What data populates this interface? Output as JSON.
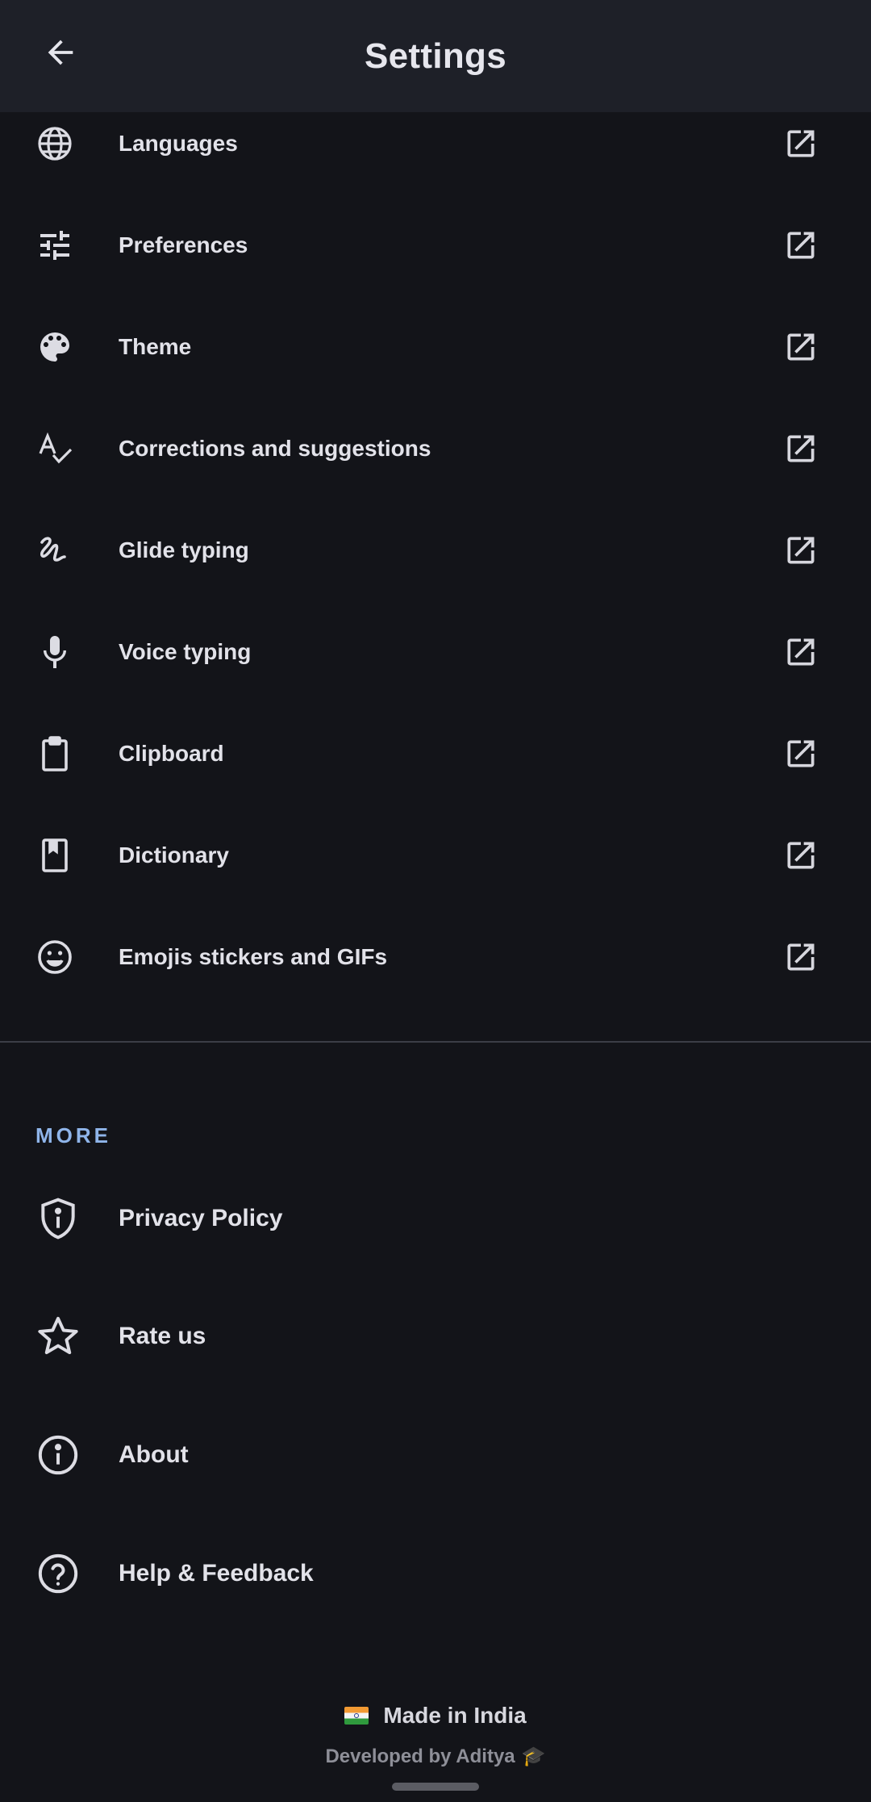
{
  "header": {
    "title": "Settings",
    "back_icon": "arrow-back-icon"
  },
  "settings_items": [
    {
      "label": "Languages",
      "icon": "globe-icon"
    },
    {
      "label": "Preferences",
      "icon": "tune-sliders-icon"
    },
    {
      "label": "Theme",
      "icon": "palette-icon"
    },
    {
      "label": "Corrections and suggestions",
      "icon": "spellcheck-icon"
    },
    {
      "label": "Glide typing",
      "icon": "gesture-icon"
    },
    {
      "label": "Voice typing",
      "icon": "microphone-icon"
    },
    {
      "label": "Clipboard",
      "icon": "clipboard-icon"
    },
    {
      "label": "Dictionary",
      "icon": "book-icon"
    },
    {
      "label": "Emojis stickers and GIFs",
      "icon": "smiley-icon"
    }
  ],
  "more_section": {
    "title": "MORE",
    "items": [
      {
        "label": "Privacy Policy",
        "icon": "shield-info-icon"
      },
      {
        "label": "Rate us",
        "icon": "star-icon"
      },
      {
        "label": "About",
        "icon": "info-icon"
      },
      {
        "label": "Help & Feedback",
        "icon": "help-icon"
      }
    ]
  },
  "footer": {
    "made_in": "Made in India",
    "developed_by": "Developed by Aditya",
    "flag_icon": "india-flag-icon",
    "cap_icon": "graduation-cap-icon"
  },
  "colors": {
    "background": "#131419",
    "appbar": "#1e2028",
    "accent": "#8fb5ea",
    "text": "#e2e2e9"
  }
}
